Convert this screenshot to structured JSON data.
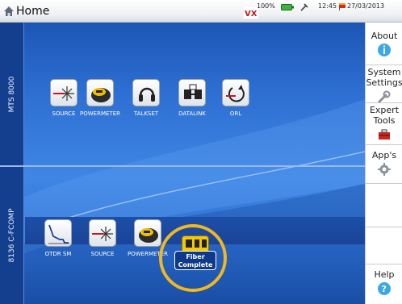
{
  "topbar": {
    "title": "Home",
    "battery": "100%",
    "time": "12:45",
    "date": "27/03/2013",
    "icons": [
      "home-icon",
      "vx-icon",
      "battery-icon",
      "plug-icon",
      "flag-icon"
    ]
  },
  "sections": [
    {
      "label": "MTS 8000",
      "tiles": [
        {
          "label": "SOURCE",
          "icon": "source-icon"
        },
        {
          "label": "POWERMETER",
          "icon": "powermeter-icon"
        },
        {
          "label": "TALKSET",
          "icon": "headset-icon"
        },
        {
          "label": "DATALINK",
          "icon": "datalink-icon"
        },
        {
          "label": "ORL",
          "icon": "orl-icon"
        }
      ]
    },
    {
      "label": "8136 C-FCOMP",
      "tiles": [
        {
          "label": "OTDR SM",
          "icon": "otdr-icon"
        },
        {
          "label": "SOURCE",
          "icon": "source-icon"
        },
        {
          "label": "POWERMETER",
          "icon": "powermeter-icon"
        }
      ],
      "fiber_complete": {
        "line1": "Fiber",
        "line2": "Complete",
        "icon": "fiber-complete-icon"
      }
    }
  ],
  "right_panel": [
    {
      "label": "About",
      "icon": "info-icon"
    },
    {
      "label": "System\nSettings",
      "icon": "wrench-icon"
    },
    {
      "label": "Expert\nTools",
      "icon": "toolbox-icon"
    },
    {
      "label": "App's",
      "icon": "apps-gear-icon"
    },
    {
      "label": "Help",
      "icon": "help-icon"
    }
  ],
  "colors": {
    "accent": "#2d6fd2",
    "highlight_ring": "#f0b820",
    "fiber_complete_label_bg": "#0f3a8a"
  }
}
